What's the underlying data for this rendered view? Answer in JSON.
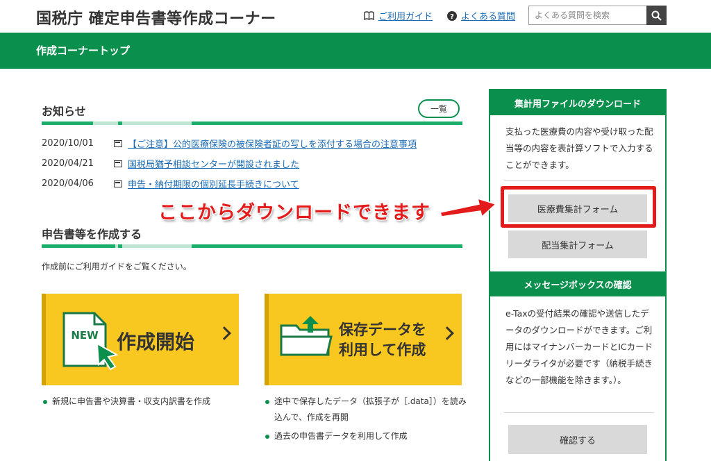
{
  "header": {
    "site_title": "国税庁 確定申告書等作成コーナー",
    "guide_link": "ご利用ガイド",
    "faq_link": "よくある質問",
    "search_placeholder": "よくある質問を検索"
  },
  "nav": {
    "title": "作成コーナートップ"
  },
  "news": {
    "title": "お知らせ",
    "more_label": "一覧",
    "items": [
      {
        "date": "2020/10/01",
        "text": "【ご注意】公的医療保険の被保険者証の写しを添付する場合の注意事項"
      },
      {
        "date": "2020/04/21",
        "text": "国税局猶予相談センターが開設されました"
      },
      {
        "date": "2020/04/06",
        "text": "申告・納付期限の個別延長手続きについて"
      }
    ]
  },
  "create": {
    "title": "申告書等を作成する",
    "guide_text": "作成前にご利用ガイドをご覧ください。",
    "new_card": {
      "badge": "NEW",
      "label": "作成開始",
      "bullets": [
        "新規に申告書や決算書・収支内訳書を作成"
      ]
    },
    "saved_card": {
      "label_line1": "保存データを",
      "label_line2": "利用して作成",
      "bullets": [
        "途中で保存したデータ（拡張子が［.data］）を読み込んで、作成を再開",
        "過去の申告書データを利用して作成"
      ]
    }
  },
  "sidebar": {
    "download": {
      "title": "集計用ファイルのダウンロード",
      "description": "支払った医療費の内容や受け取った配当等の内容を表計算ソフトで入力することができます。",
      "medical_button": "医療費集計フォーム",
      "dividend_button": "配当集計フォーム"
    },
    "messagebox": {
      "title": "メッセージボックスの確認",
      "description": "e-Taxの受付結果の確認や送信したデータのダウンロードができます。ご利用にはマイナンバーカードとICカードリーダライタが必要です（納税手続きなどの一部機能を除きます。）。",
      "confirm_button": "確認する"
    }
  },
  "annotation": {
    "text": "ここからダウンロードできます",
    "color": "#e31b1b"
  },
  "colors": {
    "brand_green": "#0b8f4d",
    "card_yellow": "#f8c820",
    "link_blue": "#1a6bb5"
  }
}
